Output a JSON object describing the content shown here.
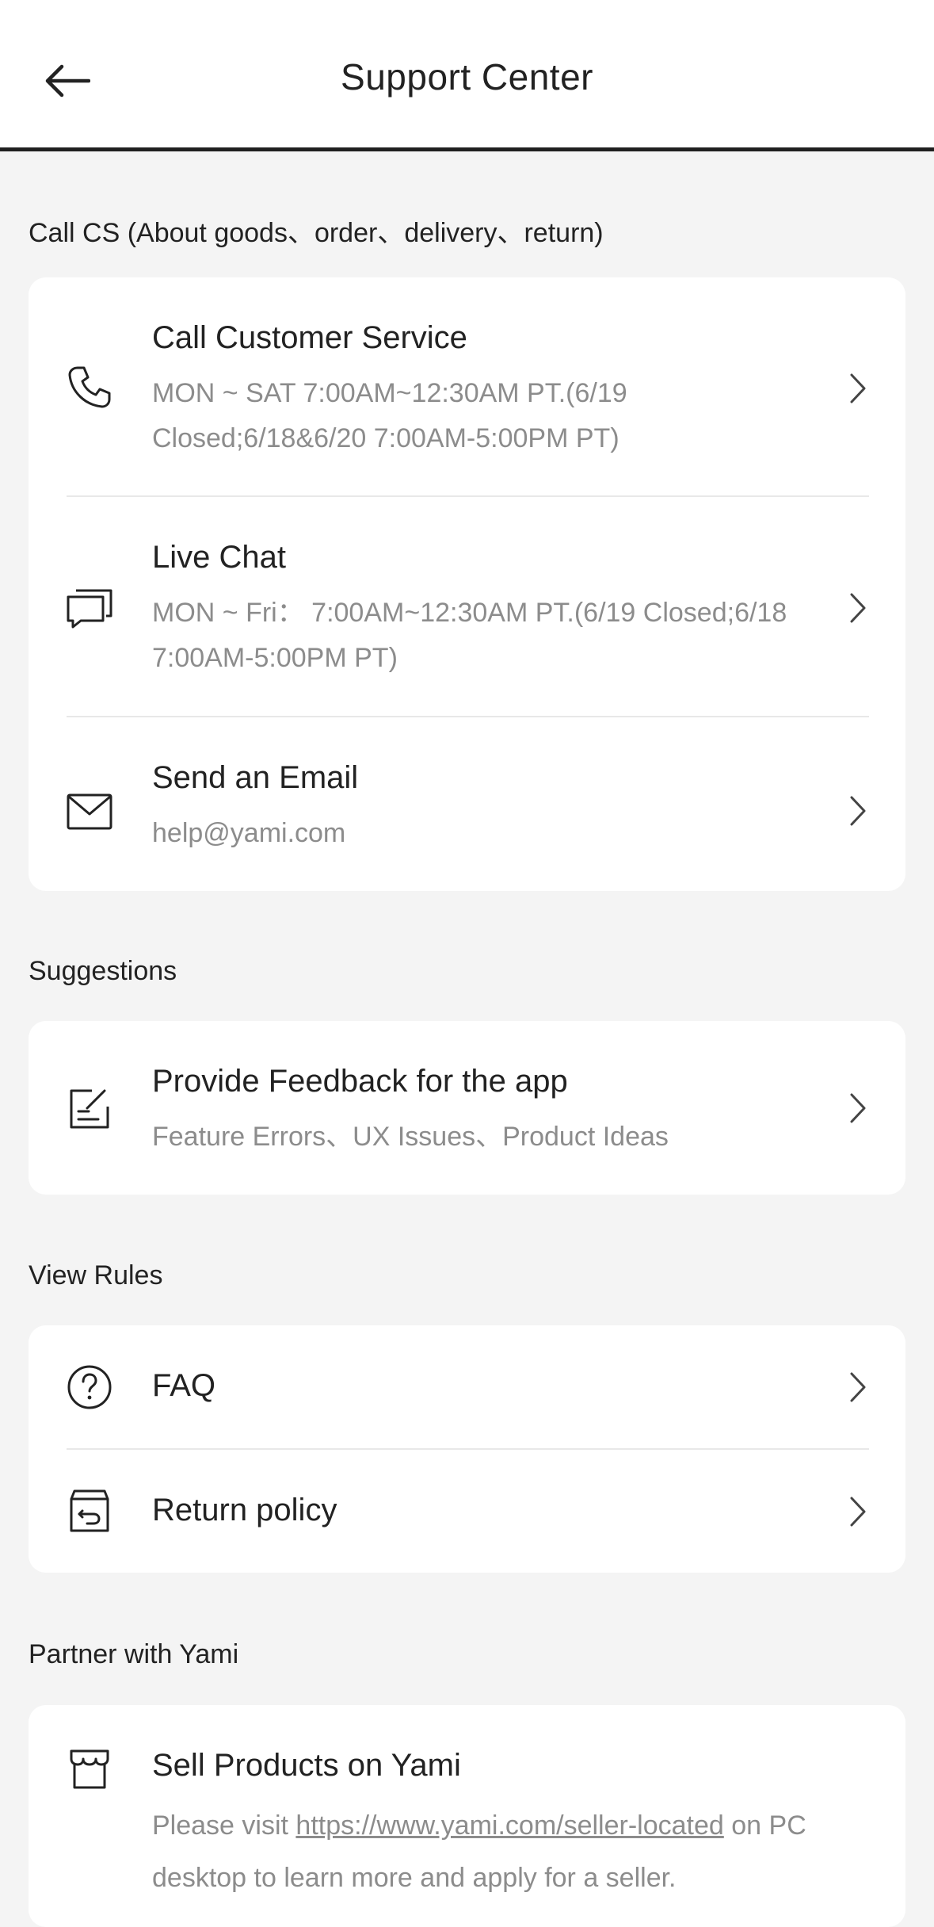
{
  "header": {
    "title": "Support Center"
  },
  "sections": {
    "call_cs": {
      "label": "Call CS (About goods、order、delivery、return)",
      "items": [
        {
          "title": "Call Customer Service",
          "subtitle": "MON ~ SAT 7:00AM~12:30AM PT.(6/19 Closed;6/18&6/20 7:00AM-5:00PM PT)",
          "icon": "phone-icon"
        },
        {
          "title": "Live Chat",
          "subtitle": "MON ~ Fri： 7:00AM~12:30AM PT.(6/19 Closed;6/18 7:00AM-5:00PM PT)",
          "icon": "chat-icon"
        },
        {
          "title": "Send an Email",
          "subtitle": "help@yami.com",
          "icon": "mail-icon"
        }
      ]
    },
    "suggestions": {
      "label": "Suggestions",
      "items": [
        {
          "title": "Provide Feedback for the app",
          "subtitle": "Feature Errors、UX  Issues、Product Ideas",
          "icon": "feedback-icon"
        }
      ]
    },
    "view_rules": {
      "label": "View Rules",
      "items": [
        {
          "title": "FAQ",
          "icon": "question-icon"
        },
        {
          "title": "Return policy",
          "icon": "return-icon"
        }
      ]
    },
    "partner": {
      "label": "Partner with Yami",
      "items": [
        {
          "title": "Sell Products on Yami",
          "subtitle_prefix": "Please visit ",
          "subtitle_link": "https://www.yami.com/seller-located",
          "subtitle_suffix": " on PC desktop to learn more and apply for a seller.",
          "icon": "store-icon"
        }
      ]
    }
  },
  "colors": {
    "background": "#f4f4f4",
    "card": "#ffffff",
    "subtext": "#8c8c8c",
    "text": "#222222"
  }
}
